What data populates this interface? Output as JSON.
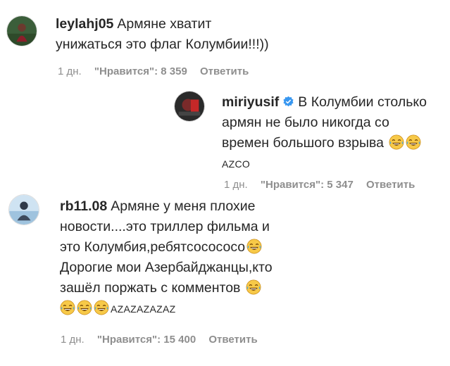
{
  "comments": [
    {
      "username": "leylahj05",
      "lines": [
        "Армяне хватит",
        "унижаться это флаг Колумбии!!!))"
      ],
      "time": "1 дн.",
      "likes": "\"Нравится\": 8 359",
      "reply": "Ответить"
    },
    {
      "username": "miriyusif",
      "verified": true,
      "lines": [
        "В Колумбии столько",
        "армян не было никогда со",
        "времен большого взрыва"
      ],
      "tail": "AZCO",
      "time": "1 дн.",
      "likes": "\"Нравится\": 5 347",
      "reply": "Ответить"
    },
    {
      "username": "rb11.08",
      "lines": [
        "Армяне у меня плохие",
        "новости....это триллер фильма и",
        "это Колумбия,ребятсосососо",
        "Дорогие мои Азербайджанцы,кто",
        "зашёл поржать с комментов"
      ],
      "tail": "AZAZAZAZAZ",
      "time": "1 дн.",
      "likes": "\"Нравится\": 15 400",
      "reply": "Ответить"
    }
  ],
  "colors": {
    "text": "#262626",
    "meta": "#8e8e8e",
    "verified": "#3897f0",
    "emoji": "#f7c948"
  },
  "icons": {
    "verified": "verified-badge-icon",
    "emoji": "tears-of-joy-emoji"
  }
}
